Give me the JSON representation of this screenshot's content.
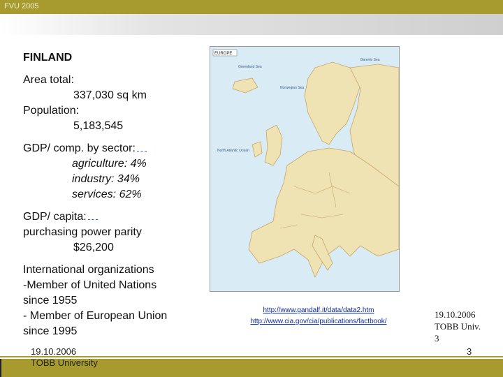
{
  "header": {
    "text": "FVU 2005"
  },
  "content": {
    "title": "FINLAND",
    "area_label": "Area total:",
    "area_value": "337,030 sq km",
    "population_label": "Population:",
    "population_value": "5,183,545",
    "gdp_sector_label": "GDP/ comp. by sector:",
    "sectors": [
      "agriculture: 4%",
      "industry: 34%",
      "services: 62%"
    ],
    "gdp_capita_label": "GDP/ capita:",
    "ppp_label": "purchasing power parity",
    "ppp_value": "$26,200",
    "intl_label": "International organizations",
    "intl_lines": [
      "-Member of United Nations",
      "since 1955",
      "- Member of European Union",
      "since 1995"
    ]
  },
  "map": {
    "title": "EUROPE",
    "labels": [
      "Greenland Sea",
      "Norwegian Sea",
      "North Atlantic Ocean",
      "Barents Sea"
    ],
    "colors": {
      "sea": "#d9ecf6",
      "land": "#efe3b4",
      "border": "#c8a468"
    }
  },
  "links": [
    "http://www.gandalf.it/data/data2.htm",
    "http://www.cia.gov/cia/publications/factbook/"
  ],
  "right_note": {
    "lines": [
      "19.10.2006",
      "TOBB Univ.",
      "3"
    ]
  },
  "footer": {
    "date": "19.10.2006",
    "org": "TOBB University",
    "page": "3"
  }
}
